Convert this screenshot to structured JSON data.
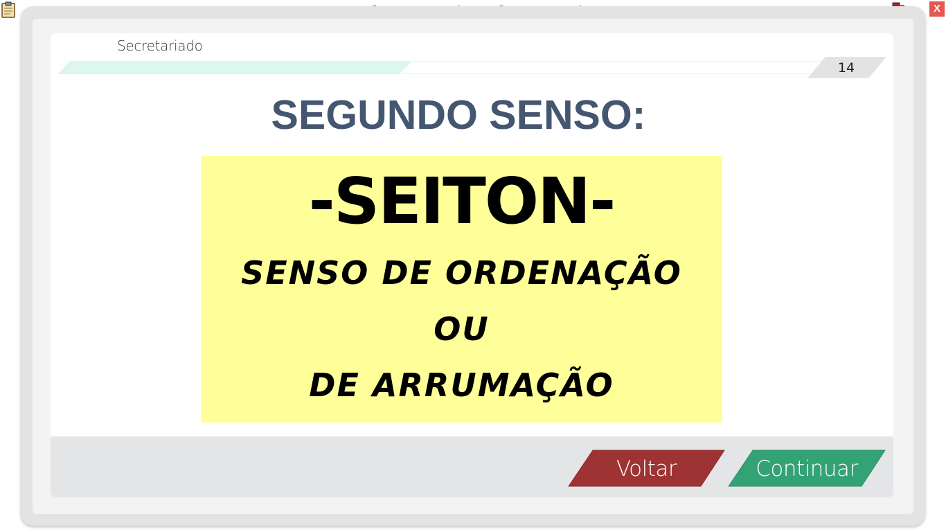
{
  "watermark": "VERSÃO PARA FUNCIONÁRIOS - NÃO COMERCIALIZÁVEL",
  "close_label": "X",
  "course_title": "Secretariado",
  "progress": {
    "fraction": 0.46
  },
  "page_number": "14",
  "slide": {
    "heading": "SEGUNDO SENSO:",
    "term": "-SEITON-",
    "line1": "SENSO DE ORDENAÇÃO",
    "line2": "OU",
    "line3": "DE ARRUMAÇÃO"
  },
  "nav": {
    "back_label": "Voltar",
    "next_label": "Continuar"
  },
  "colors": {
    "heading": "#445670",
    "highlight_box": "#ffff99",
    "back_button": "#9e3334",
    "next_button": "#33a275",
    "progress_fill": "#dcf7ee",
    "watermark": "#e86b6b"
  },
  "icons": [
    "clipboard-icon",
    "network-status-icon",
    "close-icon"
  ]
}
